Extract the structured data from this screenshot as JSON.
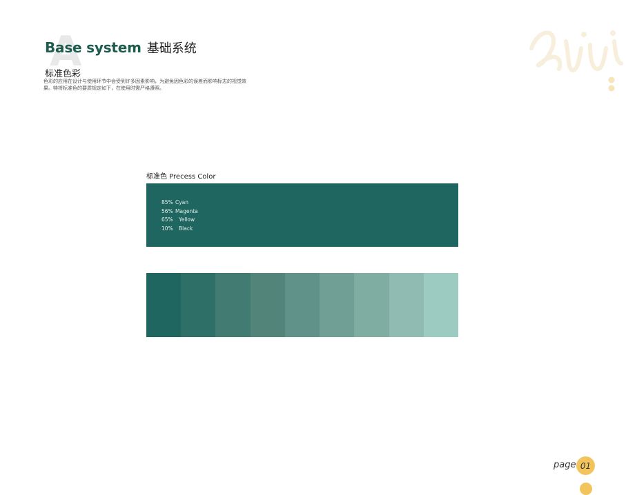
{
  "header": {
    "title_en": "Base system",
    "title_cn": "基础系统"
  },
  "section": {
    "title": "标准色彩",
    "description": "色彩的应用在设计与使用环节中会受到许多因素影响，为避免因色彩的误差而影响标志的视觉效果。特将标准色的要质规定如下，在使用时需严格遵照。"
  },
  "precess": {
    "label": "标准色  Precess Color",
    "color": "#1f6660",
    "cmyk": [
      {
        "percent": "85%",
        "name": "Cyan"
      },
      {
        "percent": "56%",
        "name": "Magenta"
      },
      {
        "percent": "65%",
        "name": "Yellow"
      },
      {
        "percent": "10%",
        "name": "Black"
      }
    ]
  },
  "tints": [
    "#1f6660",
    "#2e6f68",
    "#417b72",
    "#528479",
    "#619289",
    "#70a095",
    "#80ada2",
    "#8fbbb2",
    "#9ccbc2"
  ],
  "footer": {
    "page_word": "page",
    "page_number": "01",
    "accent_color": "#f2c55c"
  }
}
